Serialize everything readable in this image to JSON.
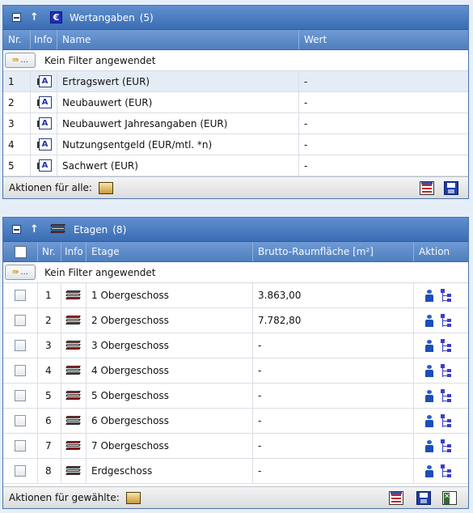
{
  "panel1": {
    "title": "Wertangaben",
    "count": "(5)",
    "columns": [
      "Nr.",
      "Info",
      "Name",
      "Wert"
    ],
    "filter_button": "...",
    "filter_text": "Kein Filter angewendet",
    "rows": [
      {
        "nr": "1",
        "name": "Ertragswert (EUR)",
        "wert": "-"
      },
      {
        "nr": "2",
        "name": "Neubauwert (EUR)",
        "wert": "-"
      },
      {
        "nr": "3",
        "name": "Neubauwert Jahresangaben (EUR)",
        "wert": "-"
      },
      {
        "nr": "4",
        "name": "Nutzungsentgeld (EUR/mtl. *n)",
        "wert": "-"
      },
      {
        "nr": "5",
        "name": "Sachwert (EUR)",
        "wert": "-"
      }
    ],
    "footer_label": "Aktionen für alle:"
  },
  "panel2": {
    "title": "Etagen",
    "count": "(8)",
    "columns": [
      "",
      "Nr.",
      "Info",
      "Etage",
      "Brutto-Raumfläche [m²]",
      "Aktion"
    ],
    "filter_button": "...",
    "filter_text": "Kein Filter angewendet",
    "rows": [
      {
        "nr": "1",
        "etage": "1 Obergeschoss",
        "flaeche": "3.863,00"
      },
      {
        "nr": "2",
        "etage": "2 Obergeschoss",
        "flaeche": "7.782,80"
      },
      {
        "nr": "3",
        "etage": "3 Obergeschoss",
        "flaeche": "-"
      },
      {
        "nr": "4",
        "etage": "4 Obergeschoss",
        "flaeche": "-"
      },
      {
        "nr": "5",
        "etage": "5 Obergeschoss",
        "flaeche": "-"
      },
      {
        "nr": "6",
        "etage": "6 Obergeschoss",
        "flaeche": "-"
      },
      {
        "nr": "7",
        "etage": "7 Obergeschoss",
        "flaeche": "-"
      },
      {
        "nr": "8",
        "etage": "Erdgeschoss",
        "flaeche": "-"
      }
    ],
    "footer_label": "Aktionen für gewählte:"
  },
  "icons": {
    "collapse": "collapse-icon",
    "sort_up": "↑",
    "euro": "€",
    "info_doc": "A"
  },
  "colors": {
    "header_blue": "#3b6db4",
    "column_header_blue": "#5585c6",
    "selected_row": "#e4ecf6",
    "background": "#e6eef7"
  }
}
